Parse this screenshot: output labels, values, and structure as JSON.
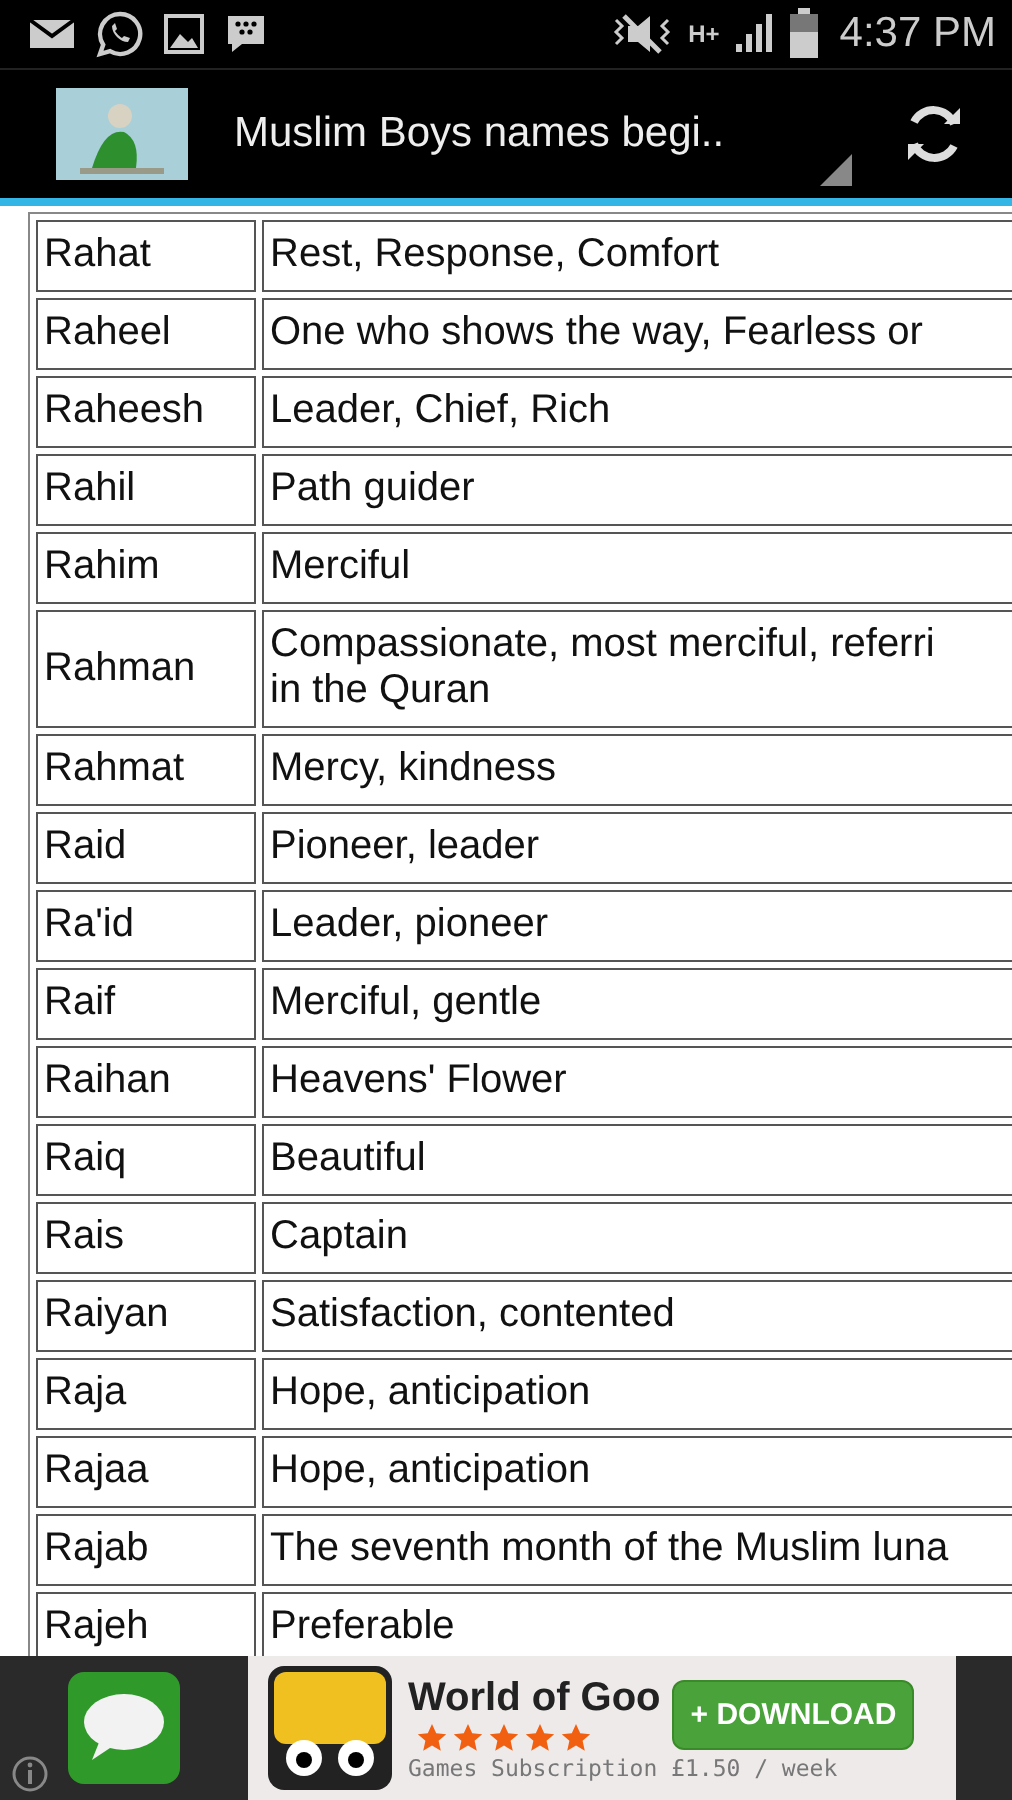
{
  "status_bar": {
    "network": "H+",
    "time": "4:37 PM"
  },
  "action_bar": {
    "title": "Muslim Boys names begi.."
  },
  "table": {
    "rows": [
      {
        "name": "Rahat",
        "meaning": [
          "Rest, Response, Comfort"
        ]
      },
      {
        "name": "Raheel",
        "meaning": [
          "One who shows the way, Fearless or"
        ]
      },
      {
        "name": "Raheesh",
        "meaning": [
          "Leader, Chief, Rich"
        ]
      },
      {
        "name": "Rahil",
        "meaning": [
          "Path guider"
        ]
      },
      {
        "name": "Rahim",
        "meaning": [
          "Merciful"
        ]
      },
      {
        "name": "Rahman",
        "meaning": [
          "Compassionate, most merciful, referri",
          "in the Quran"
        ]
      },
      {
        "name": "Rahmat",
        "meaning": [
          "Mercy, kindness"
        ]
      },
      {
        "name": "Raid",
        "meaning": [
          "Pioneer, leader"
        ]
      },
      {
        "name": "Ra'id",
        "meaning": [
          "Leader, pioneer"
        ]
      },
      {
        "name": "Raif",
        "meaning": [
          "Merciful, gentle"
        ]
      },
      {
        "name": "Raihan",
        "meaning": [
          "Heavens' Flower"
        ]
      },
      {
        "name": "Raiq",
        "meaning": [
          "Beautiful"
        ]
      },
      {
        "name": "Rais",
        "meaning": [
          "Captain"
        ]
      },
      {
        "name": "Raiyan",
        "meaning": [
          "Satisfaction, contented"
        ]
      },
      {
        "name": "Raja",
        "meaning": [
          "Hope, anticipation"
        ]
      },
      {
        "name": "Rajaa",
        "meaning": [
          "Hope, anticipation"
        ]
      },
      {
        "name": "Rajab",
        "meaning": [
          "The seventh month of the Muslim luna"
        ]
      },
      {
        "name": "Rajeh",
        "meaning": [
          "Preferable"
        ]
      }
    ]
  },
  "ad": {
    "title": "World of Goo",
    "stars": 5,
    "button": "+ DOWNLOAD",
    "subtitle": "Games Subscription £1.50 / week"
  }
}
